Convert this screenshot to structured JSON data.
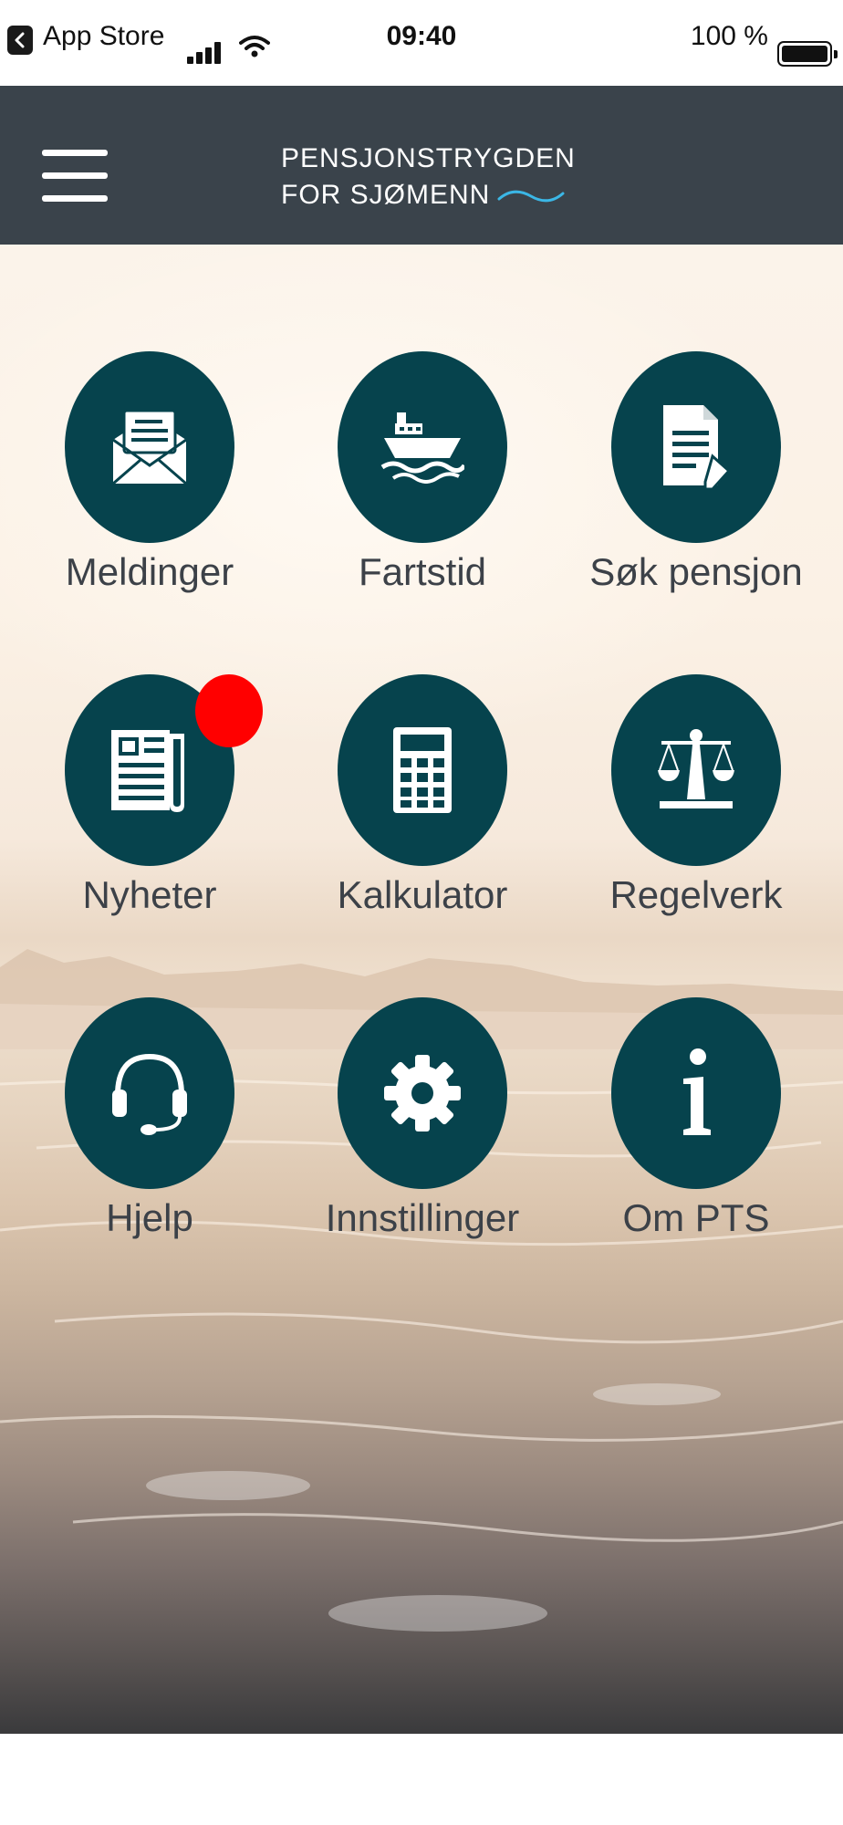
{
  "status_bar": {
    "back_app": "App Store",
    "time": "09:40",
    "battery_percent": "100 %",
    "battery_level": 1.0,
    "icons": [
      "back-arrow-icon",
      "signal-icon",
      "wifi-icon",
      "battery-icon"
    ]
  },
  "header": {
    "logo_line1": "PENSJONSTRYGDEN",
    "logo_line2": "FOR SJØMENN",
    "colors": {
      "background": "#3a434b",
      "wave": "#3bb7e6"
    }
  },
  "grid": {
    "items": [
      {
        "label": "Meldinger",
        "icon": "envelope-icon"
      },
      {
        "label": "Fartstid",
        "icon": "ship-icon"
      },
      {
        "label": "Søk pensjon",
        "icon": "document-pen-icon"
      },
      {
        "label": "Nyheter",
        "icon": "newspaper-icon",
        "has_badge": true
      },
      {
        "label": "Kalkulator",
        "icon": "calculator-icon"
      },
      {
        "label": "Regelverk",
        "icon": "scales-icon"
      },
      {
        "label": "Hjelp",
        "icon": "headset-icon"
      },
      {
        "label": "Innstillinger",
        "icon": "gear-icon"
      },
      {
        "label": "Om PTS",
        "icon": "info-icon"
      }
    ],
    "colors": {
      "circle": "#06434d",
      "badge": "#ff0000",
      "label": "#3c4148"
    }
  }
}
